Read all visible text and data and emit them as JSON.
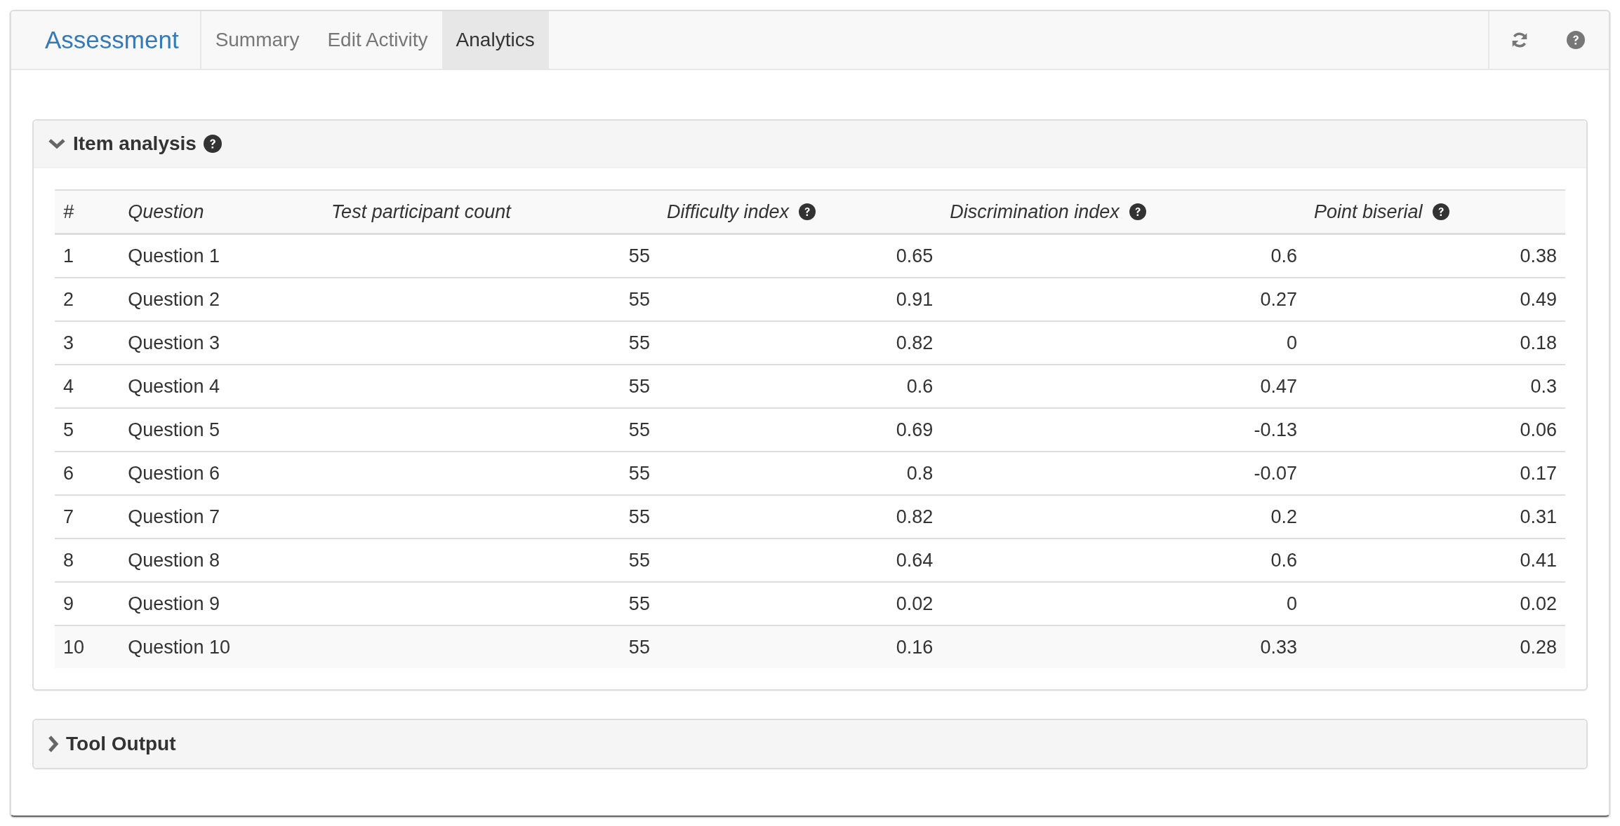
{
  "navbar": {
    "brand": "Assessment",
    "tabs": [
      {
        "label": "Summary",
        "selected": false
      },
      {
        "label": "Edit Activity",
        "selected": false
      },
      {
        "label": "Analytics",
        "selected": true
      }
    ]
  },
  "panels": [
    {
      "title": "Item analysis",
      "expanded": true,
      "help": true,
      "table": {
        "columns": [
          {
            "label": "#",
            "help": false
          },
          {
            "label": "Question",
            "help": false
          },
          {
            "label": "Test participant count",
            "help": false
          },
          {
            "label": "Difficulty index",
            "help": true
          },
          {
            "label": "Discrimination index",
            "help": true
          },
          {
            "label": "Point biserial",
            "help": true
          }
        ],
        "rows": [
          {
            "cells": [
              "1",
              "Question 1",
              "55",
              "0.65",
              "0.6",
              "0.38"
            ],
            "highlighted": false
          },
          {
            "cells": [
              "2",
              "Question 2",
              "55",
              "0.91",
              "0.27",
              "0.49"
            ],
            "highlighted": false
          },
          {
            "cells": [
              "3",
              "Question 3",
              "55",
              "0.82",
              "0",
              "0.18"
            ],
            "highlighted": false
          },
          {
            "cells": [
              "4",
              "Question 4",
              "55",
              "0.6",
              "0.47",
              "0.3"
            ],
            "highlighted": false
          },
          {
            "cells": [
              "5",
              "Question 5",
              "55",
              "0.69",
              "-0.13",
              "0.06"
            ],
            "highlighted": false
          },
          {
            "cells": [
              "6",
              "Question 6",
              "55",
              "0.8",
              "-0.07",
              "0.17"
            ],
            "highlighted": false
          },
          {
            "cells": [
              "7",
              "Question 7",
              "55",
              "0.82",
              "0.2",
              "0.31"
            ],
            "highlighted": false
          },
          {
            "cells": [
              "8",
              "Question 8",
              "55",
              "0.64",
              "0.6",
              "0.41"
            ],
            "highlighted": false
          },
          {
            "cells": [
              "9",
              "Question 9",
              "55",
              "0.02",
              "0",
              "0.02"
            ],
            "highlighted": false
          },
          {
            "cells": [
              "10",
              "Question 10",
              "55",
              "0.16",
              "0.33",
              "0.28"
            ],
            "highlighted": true
          }
        ]
      }
    },
    {
      "title": "Tool Output",
      "expanded": false,
      "help": false
    }
  ]
}
